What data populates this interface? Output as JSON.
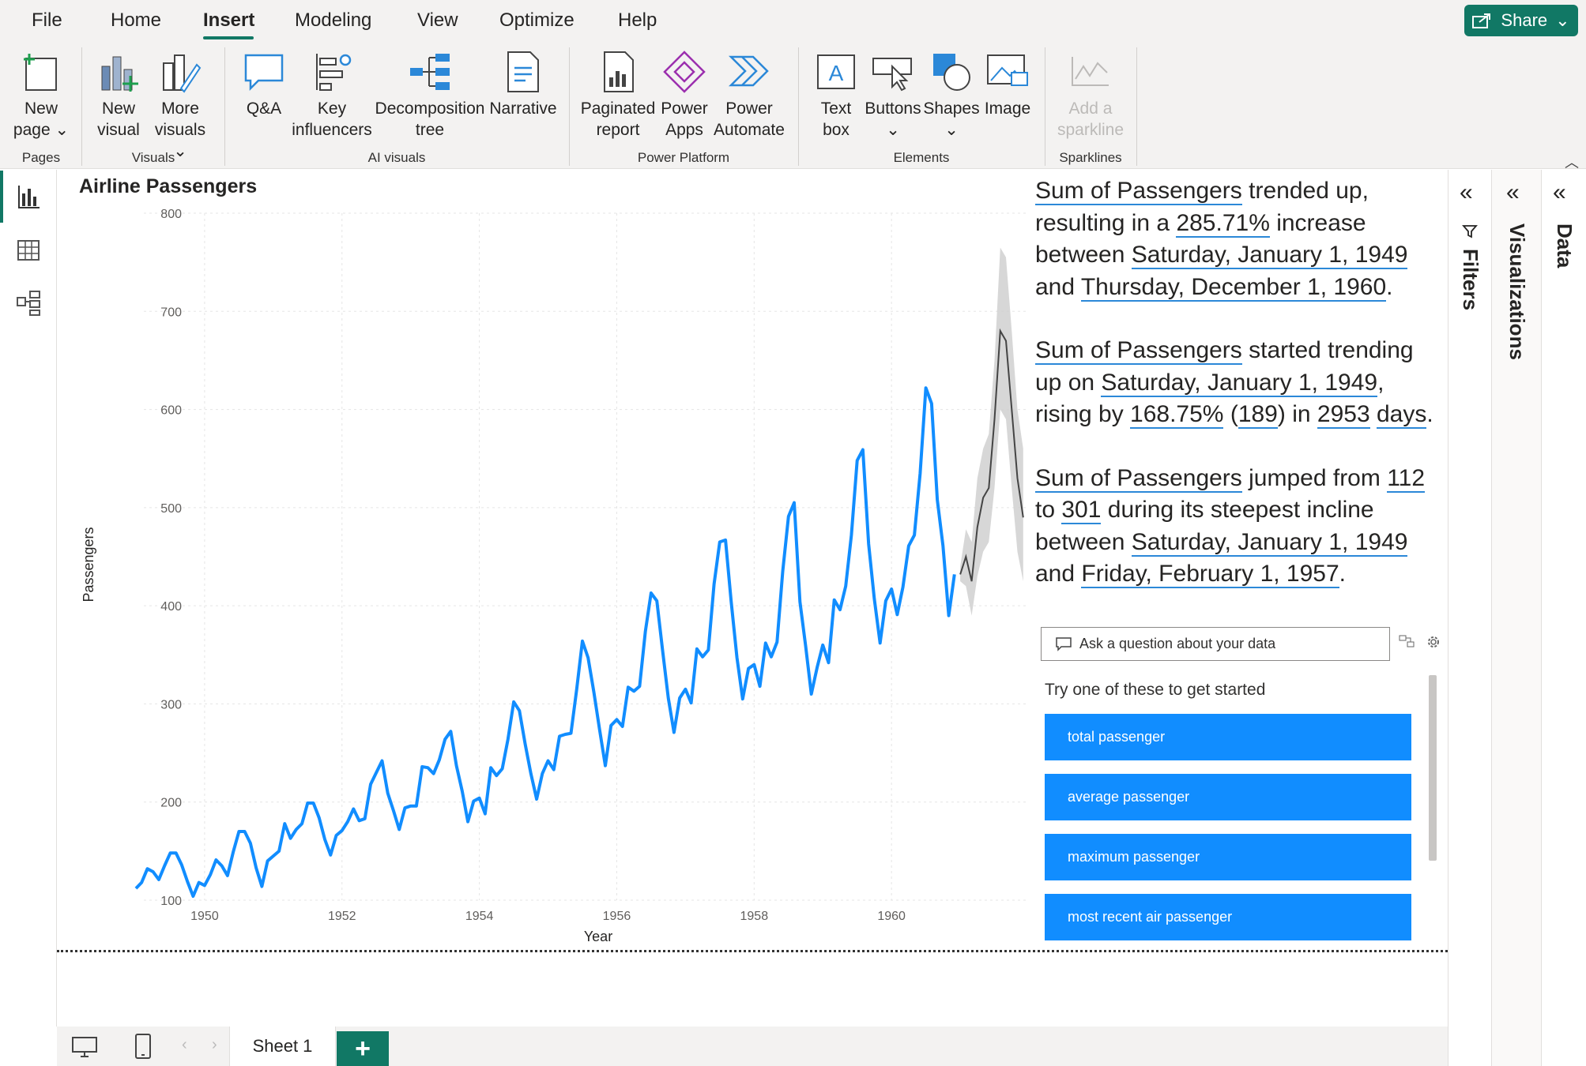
{
  "menu": {
    "items": [
      "File",
      "Home",
      "Insert",
      "Modeling",
      "View",
      "Optimize",
      "Help"
    ],
    "active": "Insert",
    "share_label": "Share"
  },
  "ribbon": {
    "buttons": [
      {
        "id": "new-page",
        "label": "New\npage ⌄",
        "icon": "new-page-icon"
      },
      {
        "id": "new-visual",
        "label": "New\nvisual",
        "icon": "new-visual-icon"
      },
      {
        "id": "more-visuals",
        "label": "More\nvisuals ⌄",
        "icon": "more-visuals-icon"
      },
      {
        "id": "qa",
        "label": "Q&A",
        "icon": "qa-icon"
      },
      {
        "id": "key-influencers",
        "label": "Key\ninfluencers",
        "icon": "key-influencers-icon"
      },
      {
        "id": "decomposition-tree",
        "label": "Decomposition\ntree",
        "icon": "decomposition-tree-icon"
      },
      {
        "id": "narrative",
        "label": "Narrative",
        "icon": "narrative-icon"
      },
      {
        "id": "paginated-report",
        "label": "Paginated\nreport",
        "icon": "paginated-report-icon"
      },
      {
        "id": "power-apps",
        "label": "Power\nApps",
        "icon": "power-apps-icon"
      },
      {
        "id": "power-automate",
        "label": "Power\nAutomate",
        "icon": "power-automate-icon"
      },
      {
        "id": "text-box",
        "label": "Text\nbox",
        "icon": "text-box-icon"
      },
      {
        "id": "buttons",
        "label": "Buttons\n⌄",
        "icon": "buttons-icon"
      },
      {
        "id": "shapes",
        "label": "Shapes\n⌄",
        "icon": "shapes-icon"
      },
      {
        "id": "image",
        "label": "Image",
        "icon": "image-icon"
      },
      {
        "id": "add-sparkline",
        "label": "Add a\nsparkline",
        "icon": "sparkline-icon"
      }
    ],
    "groups": [
      "Pages",
      "Visuals",
      "AI visuals",
      "Power Platform",
      "Elements",
      "Sparklines"
    ]
  },
  "chart": {
    "title": "Airline Passengers",
    "xlabel": "Year",
    "ylabel": "Passengers"
  },
  "chart_data": {
    "type": "line",
    "title": "Airline Passengers",
    "xlabel": "Year",
    "ylabel": "Passengers",
    "xlim": [
      1949,
      1962
    ],
    "ylim": [
      100,
      800
    ],
    "x_ticks": [
      "1950",
      "1952",
      "1954",
      "1956",
      "1958",
      "1960"
    ],
    "y_ticks": [
      "100",
      "200",
      "300",
      "400",
      "500",
      "600",
      "700",
      "800"
    ],
    "grid": true,
    "start": "1949-01",
    "frequency": "monthly",
    "series": [
      {
        "values": [
          112,
          118,
          132,
          129,
          121,
          135,
          148,
          148,
          136,
          119,
          104,
          118,
          115,
          126,
          141,
          135,
          125,
          149,
          170,
          170,
          158,
          133,
          114,
          140,
          145,
          150,
          178,
          163,
          172,
          178,
          199,
          199,
          184,
          162,
          146,
          166,
          171,
          180,
          193,
          181,
          183,
          218,
          230,
          242,
          209,
          191,
          172,
          194,
          196,
          196,
          236,
          235,
          229,
          243,
          264,
          272,
          237,
          211,
          180,
          201,
          204,
          188,
          235,
          227,
          234,
          264,
          302,
          293,
          259,
          229,
          203,
          229,
          242,
          233,
          267,
          269,
          270,
          315,
          364,
          347,
          312,
          274,
          237,
          278,
          284,
          277,
          317,
          313,
          318,
          374,
          413,
          405,
          355,
          306,
          271,
          306,
          315,
          301,
          356,
          348,
          355,
          422,
          465,
          467,
          404,
          347,
          305,
          336,
          340,
          318,
          362,
          348,
          363,
          435,
          491,
          505,
          404,
          359,
          310,
          337,
          360,
          342,
          406,
          396,
          420,
          472,
          548,
          559,
          463,
          407,
          362,
          405,
          417,
          391,
          419,
          461,
          472,
          535,
          622,
          606,
          508,
          461,
          390,
          432
        ]
      },
      {
        "name": "forecast",
        "start": "1961-01",
        "values": [
          432,
          450,
          425,
          480,
          510,
          520,
          590,
          680,
          670,
          600,
          530,
          490
        ],
        "upper": [
          440,
          478,
          465,
          530,
          560,
          575,
          650,
          765,
          755,
          680,
          600,
          560
        ],
        "lower": [
          425,
          420,
          390,
          430,
          455,
          465,
          520,
          600,
          590,
          520,
          455,
          425
        ]
      }
    ]
  },
  "narrative": {
    "p1": {
      "a": "Sum of Passengers",
      "b": " trended up, resulting in a ",
      "c": "285.71%",
      "d": " increase between ",
      "e": "Saturday, January 1, 1949",
      "f": " and ",
      "g": "Thursday, December 1, 1960",
      "h": "."
    },
    "p2": {
      "a": "Sum of Passengers",
      "b": " started trending up on ",
      "c": "Saturday, January 1, 1949",
      "d": ", rising by ",
      "e": "168.75%",
      "f": " (",
      "g": "189",
      "h": ") in ",
      "i": "2953",
      "j": " ",
      "k": "days",
      "l": "."
    },
    "p3": {
      "a": "Sum of Passengers",
      "b": " jumped from ",
      "c": "112",
      "d": " to ",
      "e": "301",
      "f": " during its steepest incline between ",
      "g": "Saturday, January 1, 1949",
      "h": " and ",
      "i": "Friday, February 1, 1957",
      "j": "."
    }
  },
  "qna": {
    "placeholder": "Ask a question about your data",
    "prompt": "Try one of these to get started",
    "suggestions": [
      "total passenger",
      "average passenger",
      "maximum passenger",
      "most recent air passenger"
    ]
  },
  "panes": {
    "filters": "Filters",
    "visualizations": "Visualizations",
    "data": "Data"
  },
  "sheets": {
    "tab": "Sheet 1",
    "add": "+"
  },
  "colors": {
    "accent": "#117865",
    "line": "#118dff",
    "forecast": "#444444",
    "band": "#d0d0d0"
  }
}
